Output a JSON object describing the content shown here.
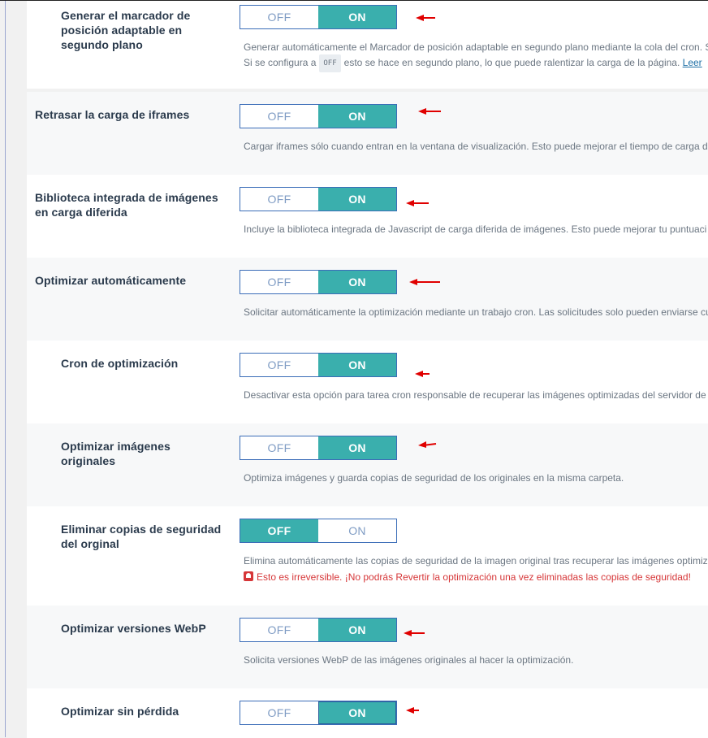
{
  "toggle_labels": {
    "off": "OFF",
    "on": "ON"
  },
  "accent_color": "#3aafad",
  "settings": [
    {
      "label": "Generar el marcador de posición adaptable en segundo plano",
      "state": "on",
      "desc1": "Generar automáticamente el Marcador de posición adaptable en segundo plano mediante la cola del cron. S",
      "desc2_before": "Si se configura a",
      "desc2_pill": "OFF",
      "desc2_after": "esto se hace en segundo plano, lo que puede ralentizar la carga de la página.",
      "desc2_link": "Leer"
    },
    {
      "label": "Retrasar la carga de iframes",
      "state": "on",
      "desc1": "Cargar iframes sólo cuando entran en la ventana de visualización. Esto puede mejorar el tiempo de carga d"
    },
    {
      "label": "Biblioteca integrada de imágenes en carga diferida",
      "state": "on",
      "desc1": "Incluye la biblioteca integrada de Javascript de carga diferida de imágenes. Esto puede mejorar tu puntuaci"
    },
    {
      "label": "Optimizar automáticamente",
      "state": "on",
      "desc1": "Solicitar automáticamente la optimización mediante un trabajo cron. Las solicitudes solo pueden enviarse cu"
    },
    {
      "label": "Cron de optimización",
      "state": "on",
      "desc1": "Desactivar esta opción para tarea cron responsable de recuperar las imágenes optimizadas del servidor de"
    },
    {
      "label": "Optimizar imágenes originales",
      "state": "on",
      "desc1": "Optimiza imágenes y guarda copias de seguridad de los originales en la misma carpeta."
    },
    {
      "label": "Eliminar copias de seguridad del orginal",
      "state": "off",
      "desc1": "Elimina automáticamente las copias de seguridad de la imagen original tras recuperar las imágenes optimiz",
      "warning": "Esto es irreversible. ¡No podrás Revertir la optimización una vez eliminadas las copias de seguridad!"
    },
    {
      "label": "Optimizar versiones WebP",
      "state": "on",
      "desc1": "Solicita versiones WebP de las imágenes originales al hacer la optimización."
    },
    {
      "label": "Optimizar sin pérdida",
      "state": "on"
    }
  ]
}
